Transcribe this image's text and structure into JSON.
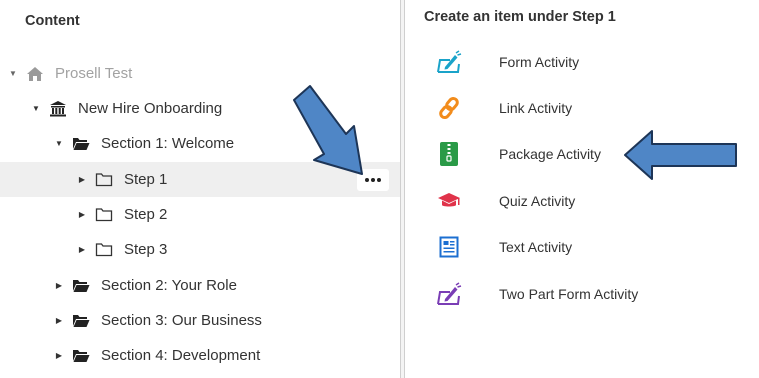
{
  "left_panel": {
    "title": "Content",
    "tree": [
      {
        "label": "Prosell Test",
        "icon": "home-icon",
        "expanded": true
      },
      {
        "label": "New Hire Onboarding",
        "icon": "bank-icon",
        "expanded": true
      },
      {
        "label": "Section 1: Welcome",
        "icon": "folder-open-icon",
        "expanded": true
      },
      {
        "label": "Step 1",
        "icon": "folder-icon",
        "expanded": false,
        "selected": true
      },
      {
        "label": "Step 2",
        "icon": "folder-icon",
        "expanded": false
      },
      {
        "label": "Step 3",
        "icon": "folder-icon",
        "expanded": false
      },
      {
        "label": "Section 2: Your Role",
        "icon": "folder-open-icon",
        "expanded": false
      },
      {
        "label": "Section 3: Our Business",
        "icon": "folder-open-icon",
        "expanded": false
      },
      {
        "label": "Section 4: Development",
        "icon": "folder-open-icon",
        "expanded": false
      }
    ],
    "more_button_icon": "ellipsis-icon"
  },
  "right_panel": {
    "title": "Create an item under Step 1",
    "activities": [
      {
        "label": "Form Activity",
        "icon": "form-pen-icon",
        "color": "#1aa3c9"
      },
      {
        "label": "Link Activity",
        "icon": "link-icon",
        "color": "#f28c1c"
      },
      {
        "label": "Package Activity",
        "icon": "zip-package-icon",
        "color": "#2a9a47"
      },
      {
        "label": "Quiz Activity",
        "icon": "graduation-cap-icon",
        "color": "#e0334a"
      },
      {
        "label": "Text Activity",
        "icon": "text-document-icon",
        "color": "#1c6fd1"
      },
      {
        "label": "Two Part Form Activity",
        "icon": "form-pen-icon",
        "color": "#7a3db5"
      }
    ]
  },
  "annotation_arrow_color": "#4f86c6"
}
